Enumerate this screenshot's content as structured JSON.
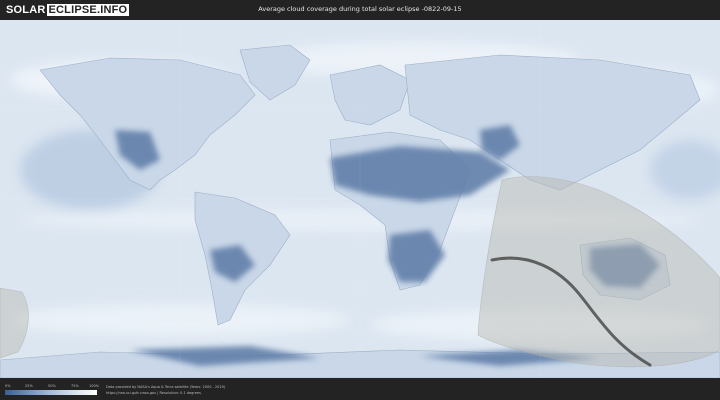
{
  "header": {
    "logo_part1": "SOLAR",
    "logo_part2": "ECLIPSE.INFO",
    "title": "Average cloud coverage during total solar eclipse -0822-09-15"
  },
  "legend": {
    "ticks": [
      "0%",
      "25%",
      "50%",
      "75%",
      "100%"
    ],
    "colors": [
      "#3a5f92",
      "#6f8fbc",
      "#a7bcd9",
      "#d8e2ef",
      "#ffffff"
    ]
  },
  "footer": {
    "credit_line1": "Data provided by NASA's Aqua & Terra satellite (Years: 2000 - 2019)",
    "credit_line2": "https://neo.sci.gsfc.nasa.gov | Resolution: 0.1 degrees"
  },
  "colors": {
    "background": "#232323",
    "map_base": "#dde7f2",
    "land_clear": "#5c7aa6",
    "eclipse_region": "#b8b8b0",
    "eclipse_path": "#3a3a3a"
  }
}
